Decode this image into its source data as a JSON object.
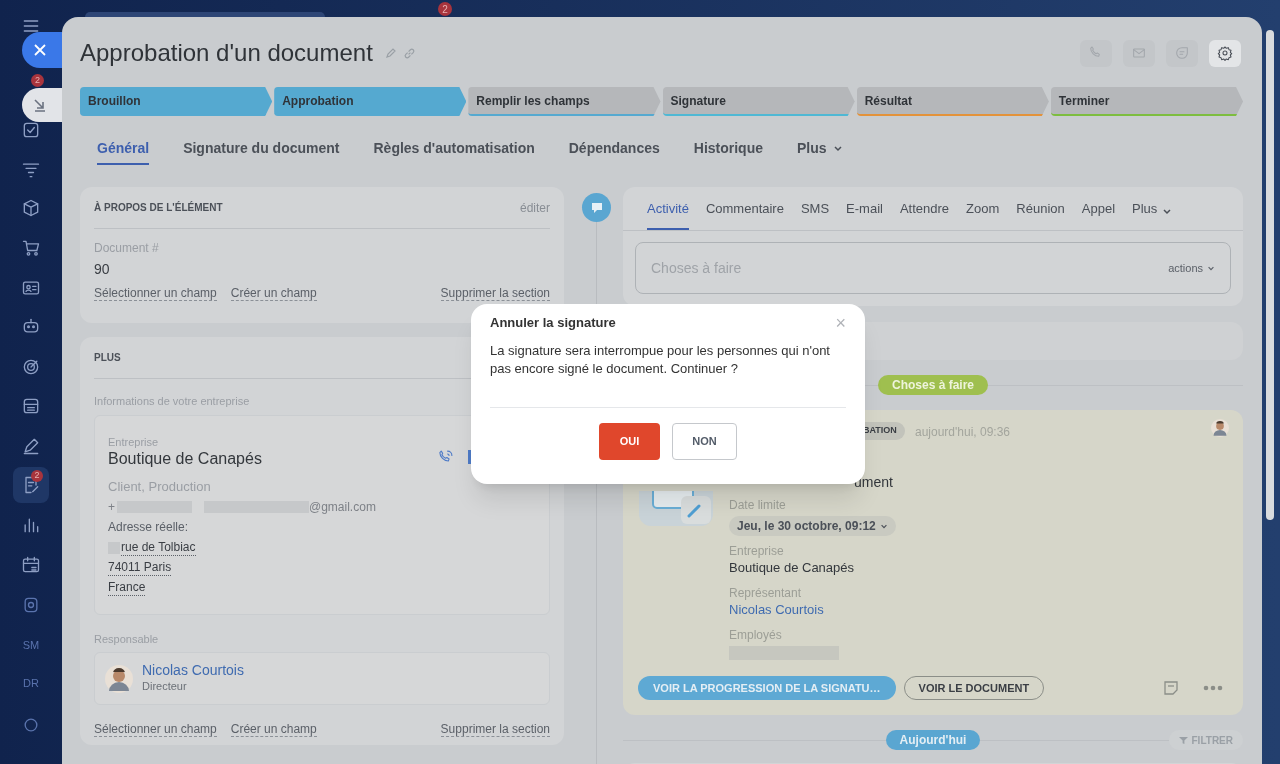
{
  "top_bar": {
    "notifications": "2"
  },
  "sidebar": {
    "items": [
      {
        "selected": false,
        "dimmed": false
      },
      {
        "selected": false,
        "dimmed": false
      },
      {
        "selected": false,
        "dimmed": false
      },
      {
        "selected": false,
        "dimmed": false
      },
      {
        "selected": false,
        "dimmed": false
      },
      {
        "selected": false,
        "dimmed": false
      },
      {
        "selected": false,
        "dimmed": false
      },
      {
        "selected": false,
        "dimmed": false
      },
      {
        "selected": false,
        "dimmed": false
      },
      {
        "selected": false,
        "dimmed": false
      },
      {
        "selected": true,
        "dimmed": false,
        "badge": "2"
      },
      {
        "selected": false,
        "dimmed": false
      },
      {
        "selected": false,
        "dimmed": false
      },
      {
        "selected": false,
        "dimmed": true
      },
      {
        "selected": false,
        "dimmed": true,
        "label": "SM"
      },
      {
        "selected": false,
        "dimmed": true,
        "label": "DR"
      },
      {
        "selected": false,
        "dimmed": true
      }
    ]
  },
  "collapse_button": {
    "badge": "2"
  },
  "panel": {
    "title": "Approbation d'un document",
    "header_actions": [
      {
        "enabled": false
      },
      {
        "enabled": false
      },
      {
        "enabled": false
      },
      {
        "enabled": true
      }
    ],
    "stages": [
      {
        "label": "Brouillon",
        "color": "#55a9d0",
        "passed": true
      },
      {
        "label": "Approbation",
        "color": "#55a9d0",
        "passed": true
      },
      {
        "label": "Remplir les champs",
        "color": "#55a9d0",
        "passed": false
      },
      {
        "label": "Signature",
        "color": "#4fb8d4",
        "passed": false
      },
      {
        "label": "Résultat",
        "color": "#e3923a",
        "passed": false
      },
      {
        "label": "Terminer",
        "color": "#7dbd3f",
        "passed": false
      }
    ],
    "tabs": [
      {
        "label": "Général",
        "selected": true,
        "kind": "plain"
      },
      {
        "label": "Signature du document",
        "selected": false,
        "kind": "plain"
      },
      {
        "label": "Règles d'automatisation",
        "selected": false,
        "kind": "plain"
      },
      {
        "label": "Dépendances",
        "selected": false,
        "kind": "plain"
      },
      {
        "label": "Historique",
        "selected": false,
        "kind": "plain"
      },
      {
        "label": "Plus",
        "selected": false,
        "kind": "dropdown"
      }
    ],
    "about_card": {
      "title": "À PROPOS DE L'ÉLÉMENT",
      "edit": "éditer",
      "field_label": "Document #",
      "field_value": "90",
      "links": [
        "Sélectionner un champ",
        "Créer un champ",
        "Supprimer la section"
      ]
    },
    "plus_card": {
      "title": "PLUS",
      "company_info_label": "Informations de votre entreprise",
      "company": {
        "label": "Entreprise",
        "name": "Boutique de Canapés",
        "types": "Client, Production",
        "phone_prefix": "+",
        "email_suffix": "@gmail.com",
        "address_label": "Adresse réelle:",
        "address_lines": [
          "rue de Tolbiac",
          "74011 Paris",
          "France"
        ]
      },
      "responsible_label": "Responsable",
      "responsible": {
        "name": "Nicolas Courtois",
        "role": "Directeur"
      },
      "links": [
        "Sélectionner un champ",
        "Créer un champ",
        "Supprimer la section"
      ]
    },
    "timeline": {
      "composer": {
        "tabs": [
          {
            "label": "Activité",
            "selected": true,
            "kind": "plain"
          },
          {
            "label": "Commentaire",
            "selected": false,
            "kind": "plain"
          },
          {
            "label": "SMS",
            "selected": false,
            "kind": "plain"
          },
          {
            "label": "E-mail",
            "selected": false,
            "kind": "plain"
          },
          {
            "label": "Attendre",
            "selected": false,
            "kind": "plain"
          },
          {
            "label": "Zoom",
            "selected": false,
            "kind": "plain"
          },
          {
            "label": "Réunion",
            "selected": false,
            "kind": "plain"
          },
          {
            "label": "Appel",
            "selected": false,
            "kind": "plain"
          },
          {
            "label": "Plus",
            "selected": false,
            "kind": "dropdown"
          }
        ],
        "placeholder": "Choses à faire",
        "actions": "actions"
      },
      "todo_label": "Choses à faire",
      "activity": {
        "tag": "BATION",
        "time": "aujourd'hui, 09:36",
        "title_tail": "ument",
        "fields": [
          {
            "label": "Date limite",
            "value": "Jeu, le 30 octobre, 09:12",
            "kind": "date"
          },
          {
            "label": "Entreprise",
            "value": "Boutique de Canapés",
            "kind": "text"
          },
          {
            "label": "Représentant",
            "value": "Nicolas Courtois",
            "kind": "link"
          },
          {
            "label": "Employés",
            "kind": "blurred"
          }
        ],
        "buttons": [
          {
            "label": "VOIR LA PROGRESSION DE LA SIGNATU…",
            "kind": "primary"
          },
          {
            "label": "VOIR LE DOCUMENT",
            "kind": "outline"
          }
        ]
      },
      "today_label": "Aujourd'hui",
      "filter": "FILTRER"
    }
  },
  "dialog": {
    "title": "Annuler la signature",
    "close": "×",
    "message": "La signature sera interrompue pour les personnes qui n'ont pas encore signé le document. Continuer ?",
    "buttons": [
      {
        "label": "OUI",
        "kind": "danger"
      },
      {
        "label": "NON",
        "kind": "outline"
      }
    ]
  }
}
